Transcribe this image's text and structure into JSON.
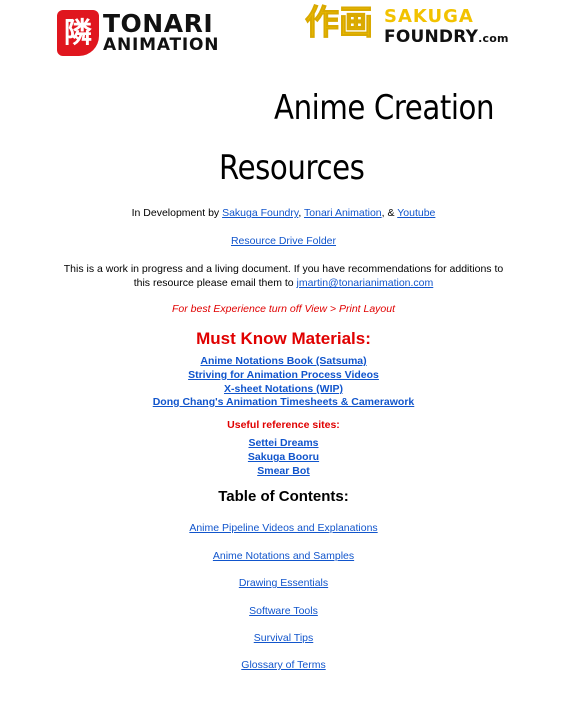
{
  "logos": {
    "tonari": {
      "badge_glyph": "隣",
      "title": "TONARI",
      "subtitle": "ANIMATION"
    },
    "sakuga": {
      "kanji": "作画",
      "word": "SAKUGA",
      "foundry": "FOUNDRY",
      "dotcom": ".com"
    }
  },
  "title": {
    "line1": "Anime Creation",
    "line2": "Resources"
  },
  "credits": {
    "prefix": "In Development by ",
    "link1": "Sakuga Foundry",
    "sep1": ", ",
    "link2": "Tonari Animation",
    "sep2": ", & ",
    "link3": "Youtube"
  },
  "drive_link": "Resource Drive Folder",
  "intro": {
    "line1": "This is a work in progress and a living document. If you have recommendations for additions to",
    "line2_prefix": "this resource please email them to ",
    "email": "jmartin@tonarianimation.com"
  },
  "note": "For best Experience turn off View > Print Layout",
  "must_know": {
    "heading": "Must Know Materials:",
    "items": [
      "Anime Notations Book (Satsuma)",
      "Striving for Animation Process Videos",
      "X-sheet Notations (WIP)",
      "Dong Chang's Animation Timesheets & Camerawork"
    ]
  },
  "useful": {
    "heading": "Useful reference sites:",
    "items": [
      "Settei Dreams",
      "Sakuga Booru",
      "Smear Bot"
    ]
  },
  "toc": {
    "heading": "Table of Contents:",
    "items": [
      "Anime Pipeline Videos and Explanations",
      "Anime Notations and Samples",
      "Drawing Essentials",
      "Software Tools",
      "Survival Tips",
      "Glossary of Terms"
    ]
  },
  "colors": {
    "link": "#1155cc",
    "red": "#e00000",
    "tonari_red": "#e0161e",
    "sakuga_yellow": "#f2c200"
  }
}
